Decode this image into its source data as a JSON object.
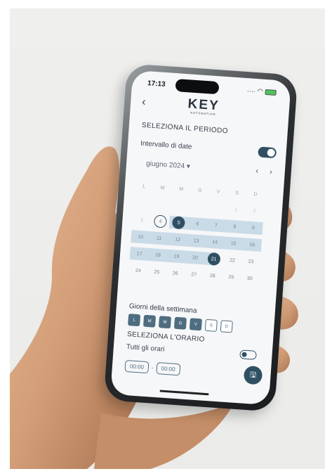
{
  "status": {
    "time": "17:13"
  },
  "brand": {
    "logo": "KEY",
    "tagline": "AUTOMATION"
  },
  "period": {
    "heading": "SELEZIONA IL PERIODO",
    "range_label": "Intervallo di date",
    "range_on": true,
    "month_label": "giugno 2024 ▾"
  },
  "calendar": {
    "weekdays": [
      "L",
      "M",
      "M",
      "G",
      "V",
      "S",
      "D"
    ],
    "rows": [
      [
        "",
        "",
        "",
        "",
        "",
        "1",
        "2"
      ],
      [
        "3",
        "4",
        "5",
        "6",
        "7",
        "8",
        "9"
      ],
      [
        "10",
        "11",
        "12",
        "13",
        "14",
        "15",
        "16"
      ],
      [
        "17",
        "18",
        "19",
        "20",
        "21",
        "22",
        "23"
      ],
      [
        "24",
        "25",
        "26",
        "27",
        "28",
        "29",
        "30"
      ]
    ],
    "today": "4",
    "range_start": "5",
    "range_end": "21"
  },
  "weekdays_section": {
    "heading": "Giorni della settimana",
    "days": [
      {
        "label": "L",
        "on": true
      },
      {
        "label": "M",
        "on": true
      },
      {
        "label": "M",
        "on": true
      },
      {
        "label": "G",
        "on": true
      },
      {
        "label": "V",
        "on": true
      },
      {
        "label": "S",
        "on": false
      },
      {
        "label": "D",
        "on": false
      }
    ]
  },
  "schedule": {
    "heading": "SELEZIONA L'ORARIO",
    "all_hours_label": "Tutti gli orari",
    "all_hours_on": false,
    "start_time": "00:00",
    "separator": "-",
    "end_time": "00:00"
  },
  "icons": {
    "back": "chevron-left-icon",
    "month_prev": "chevron-left-icon",
    "month_next": "chevron-right-icon",
    "save": "save-icon"
  },
  "colors": {
    "accent": "#2f4f63",
    "range": "#c9dbe7"
  }
}
